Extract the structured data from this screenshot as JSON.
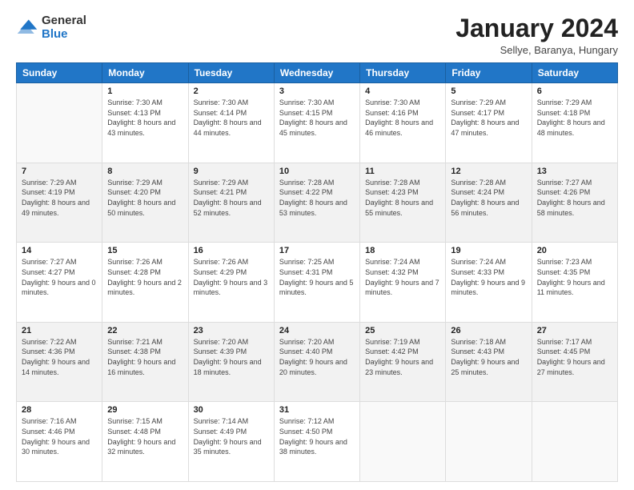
{
  "header": {
    "logo": {
      "general": "General",
      "blue": "Blue"
    },
    "title": "January 2024",
    "subtitle": "Sellye, Baranya, Hungary"
  },
  "days_of_week": [
    "Sunday",
    "Monday",
    "Tuesday",
    "Wednesday",
    "Thursday",
    "Friday",
    "Saturday"
  ],
  "weeks": [
    [
      {
        "day": "",
        "sunrise": "",
        "sunset": "",
        "daylight": ""
      },
      {
        "day": "1",
        "sunrise": "Sunrise: 7:30 AM",
        "sunset": "Sunset: 4:13 PM",
        "daylight": "Daylight: 8 hours and 43 minutes."
      },
      {
        "day": "2",
        "sunrise": "Sunrise: 7:30 AM",
        "sunset": "Sunset: 4:14 PM",
        "daylight": "Daylight: 8 hours and 44 minutes."
      },
      {
        "day": "3",
        "sunrise": "Sunrise: 7:30 AM",
        "sunset": "Sunset: 4:15 PM",
        "daylight": "Daylight: 8 hours and 45 minutes."
      },
      {
        "day": "4",
        "sunrise": "Sunrise: 7:30 AM",
        "sunset": "Sunset: 4:16 PM",
        "daylight": "Daylight: 8 hours and 46 minutes."
      },
      {
        "day": "5",
        "sunrise": "Sunrise: 7:29 AM",
        "sunset": "Sunset: 4:17 PM",
        "daylight": "Daylight: 8 hours and 47 minutes."
      },
      {
        "day": "6",
        "sunrise": "Sunrise: 7:29 AM",
        "sunset": "Sunset: 4:18 PM",
        "daylight": "Daylight: 8 hours and 48 minutes."
      }
    ],
    [
      {
        "day": "7",
        "sunrise": "Sunrise: 7:29 AM",
        "sunset": "Sunset: 4:19 PM",
        "daylight": "Daylight: 8 hours and 49 minutes."
      },
      {
        "day": "8",
        "sunrise": "Sunrise: 7:29 AM",
        "sunset": "Sunset: 4:20 PM",
        "daylight": "Daylight: 8 hours and 50 minutes."
      },
      {
        "day": "9",
        "sunrise": "Sunrise: 7:29 AM",
        "sunset": "Sunset: 4:21 PM",
        "daylight": "Daylight: 8 hours and 52 minutes."
      },
      {
        "day": "10",
        "sunrise": "Sunrise: 7:28 AM",
        "sunset": "Sunset: 4:22 PM",
        "daylight": "Daylight: 8 hours and 53 minutes."
      },
      {
        "day": "11",
        "sunrise": "Sunrise: 7:28 AM",
        "sunset": "Sunset: 4:23 PM",
        "daylight": "Daylight: 8 hours and 55 minutes."
      },
      {
        "day": "12",
        "sunrise": "Sunrise: 7:28 AM",
        "sunset": "Sunset: 4:24 PM",
        "daylight": "Daylight: 8 hours and 56 minutes."
      },
      {
        "day": "13",
        "sunrise": "Sunrise: 7:27 AM",
        "sunset": "Sunset: 4:26 PM",
        "daylight": "Daylight: 8 hours and 58 minutes."
      }
    ],
    [
      {
        "day": "14",
        "sunrise": "Sunrise: 7:27 AM",
        "sunset": "Sunset: 4:27 PM",
        "daylight": "Daylight: 9 hours and 0 minutes."
      },
      {
        "day": "15",
        "sunrise": "Sunrise: 7:26 AM",
        "sunset": "Sunset: 4:28 PM",
        "daylight": "Daylight: 9 hours and 2 minutes."
      },
      {
        "day": "16",
        "sunrise": "Sunrise: 7:26 AM",
        "sunset": "Sunset: 4:29 PM",
        "daylight": "Daylight: 9 hours and 3 minutes."
      },
      {
        "day": "17",
        "sunrise": "Sunrise: 7:25 AM",
        "sunset": "Sunset: 4:31 PM",
        "daylight": "Daylight: 9 hours and 5 minutes."
      },
      {
        "day": "18",
        "sunrise": "Sunrise: 7:24 AM",
        "sunset": "Sunset: 4:32 PM",
        "daylight": "Daylight: 9 hours and 7 minutes."
      },
      {
        "day": "19",
        "sunrise": "Sunrise: 7:24 AM",
        "sunset": "Sunset: 4:33 PM",
        "daylight": "Daylight: 9 hours and 9 minutes."
      },
      {
        "day": "20",
        "sunrise": "Sunrise: 7:23 AM",
        "sunset": "Sunset: 4:35 PM",
        "daylight": "Daylight: 9 hours and 11 minutes."
      }
    ],
    [
      {
        "day": "21",
        "sunrise": "Sunrise: 7:22 AM",
        "sunset": "Sunset: 4:36 PM",
        "daylight": "Daylight: 9 hours and 14 minutes."
      },
      {
        "day": "22",
        "sunrise": "Sunrise: 7:21 AM",
        "sunset": "Sunset: 4:38 PM",
        "daylight": "Daylight: 9 hours and 16 minutes."
      },
      {
        "day": "23",
        "sunrise": "Sunrise: 7:20 AM",
        "sunset": "Sunset: 4:39 PM",
        "daylight": "Daylight: 9 hours and 18 minutes."
      },
      {
        "day": "24",
        "sunrise": "Sunrise: 7:20 AM",
        "sunset": "Sunset: 4:40 PM",
        "daylight": "Daylight: 9 hours and 20 minutes."
      },
      {
        "day": "25",
        "sunrise": "Sunrise: 7:19 AM",
        "sunset": "Sunset: 4:42 PM",
        "daylight": "Daylight: 9 hours and 23 minutes."
      },
      {
        "day": "26",
        "sunrise": "Sunrise: 7:18 AM",
        "sunset": "Sunset: 4:43 PM",
        "daylight": "Daylight: 9 hours and 25 minutes."
      },
      {
        "day": "27",
        "sunrise": "Sunrise: 7:17 AM",
        "sunset": "Sunset: 4:45 PM",
        "daylight": "Daylight: 9 hours and 27 minutes."
      }
    ],
    [
      {
        "day": "28",
        "sunrise": "Sunrise: 7:16 AM",
        "sunset": "Sunset: 4:46 PM",
        "daylight": "Daylight: 9 hours and 30 minutes."
      },
      {
        "day": "29",
        "sunrise": "Sunrise: 7:15 AM",
        "sunset": "Sunset: 4:48 PM",
        "daylight": "Daylight: 9 hours and 32 minutes."
      },
      {
        "day": "30",
        "sunrise": "Sunrise: 7:14 AM",
        "sunset": "Sunset: 4:49 PM",
        "daylight": "Daylight: 9 hours and 35 minutes."
      },
      {
        "day": "31",
        "sunrise": "Sunrise: 7:12 AM",
        "sunset": "Sunset: 4:50 PM",
        "daylight": "Daylight: 9 hours and 38 minutes."
      },
      {
        "day": "",
        "sunrise": "",
        "sunset": "",
        "daylight": ""
      },
      {
        "day": "",
        "sunrise": "",
        "sunset": "",
        "daylight": ""
      },
      {
        "day": "",
        "sunrise": "",
        "sunset": "",
        "daylight": ""
      }
    ]
  ]
}
